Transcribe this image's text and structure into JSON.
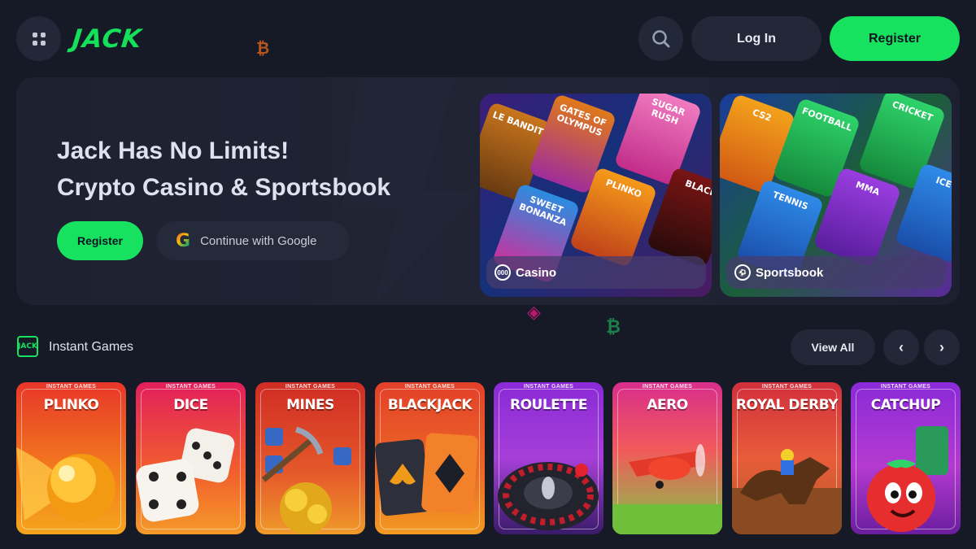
{
  "header": {
    "logo": "JACK",
    "login_label": "Log In",
    "register_label": "Register"
  },
  "hero": {
    "title_line1": "Jack Has No Limits!",
    "title_line2": "Crypto Casino & Sportsbook",
    "register_label": "Register",
    "google_label": "Continue with Google",
    "casino_label": "Casino",
    "sports_label": "Sportsbook",
    "casino_tiles": [
      "LE BANDIT",
      "GATES OF OLYMPUS",
      "SUGAR RUSH",
      "SWEET BONANZA",
      "PLINKO",
      "BLACK"
    ],
    "sports_tiles": [
      "CS2",
      "FOOTBALL",
      "CRICKET",
      "TENNIS",
      "MMA",
      "ICE-H"
    ]
  },
  "instant_games": {
    "title": "Instant Games",
    "section_icon": "JACK",
    "view_all_label": "View All",
    "prev_icon": "‹",
    "next_icon": "›",
    "tag": "INSTANT GAMES",
    "games": [
      {
        "name": "PLINKO"
      },
      {
        "name": "DICE"
      },
      {
        "name": "MINES"
      },
      {
        "name": "BLACKJACK"
      },
      {
        "name": "ROULETTE"
      },
      {
        "name": "AERO"
      },
      {
        "name": "ROYAL DERBY"
      },
      {
        "name": "CATCHUP"
      }
    ]
  },
  "colors": {
    "accent": "#17e25f",
    "background": "#161a27",
    "surface": "#232838"
  }
}
